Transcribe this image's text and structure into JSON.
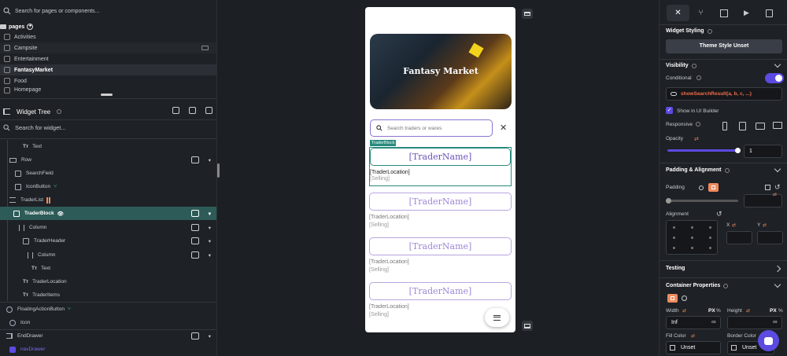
{
  "left": {
    "search_placeholder": "Search for pages or components...",
    "pages_label": "pages",
    "pages": [
      "Activities",
      "Campsite",
      "Entertainment",
      "FantasyMarket",
      "Food",
      "Homepage"
    ],
    "widget_tree_label": "Widget Tree",
    "widget_search_placeholder": "Search for widget...",
    "tree": [
      "Text",
      "Row",
      "SearchField",
      "IconButton",
      "TraderList",
      "TraderBlock",
      "Column",
      "TraderHeader",
      "Column",
      "Text",
      "TraderLocation",
      "TraderItems",
      "FloatingActionButton",
      "Icon",
      "EndDrawer",
      "navDrawer"
    ]
  },
  "canvas": {
    "hero_title": "Fantasy Market",
    "search_placeholder": "Search traders or wares",
    "tag": "TraderBlock",
    "trader_name": "[TraderName]",
    "trader_location": "[TraderLocation]",
    "selling": "[Selling]"
  },
  "right": {
    "widget_styling": "Widget Styling",
    "theme_style": "Theme Style Unset",
    "visibility": "Visibility",
    "conditional": "Conditional",
    "condition_expr": "showSearchResult(a, b, c, ...)",
    "show_in_builder": "Show in UI Builder",
    "responsive": "Responsive",
    "opacity": "Opacity",
    "opacity_value": "1",
    "padding_alignment": "Padding & Alignment",
    "padding": "Padding",
    "alignment": "Alignment",
    "x_label": "X",
    "y_label": "Y",
    "testing": "Testing",
    "container_properties": "Container Properties",
    "width": "Width",
    "height": "Height",
    "px": "PX",
    "pct": "%",
    "width_value": "Inf",
    "fill_color": "Fill Color",
    "border_color": "Border Color",
    "unset": "Unset"
  },
  "colors": {
    "accent": "#5b4be0",
    "teal": "#2a8a7e",
    "orange": "#f08a5d"
  }
}
